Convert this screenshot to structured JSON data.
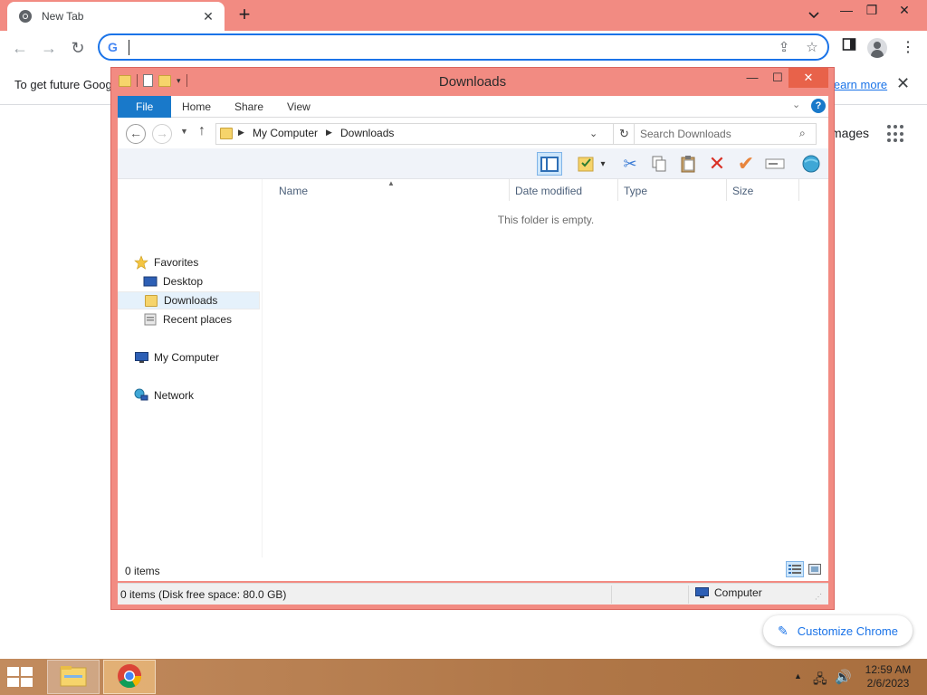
{
  "browser": {
    "tab": {
      "title": "New Tab",
      "favicon": "chrome-icon"
    },
    "omnibox": {
      "value": "",
      "placeholder": ""
    },
    "infobar": {
      "text": "To get future Goog",
      "link": "learn more"
    },
    "ntp": {
      "images_link": "mages",
      "customize_label": "Customize Chrome"
    }
  },
  "explorer": {
    "title": "Downloads",
    "ribbon_tabs": [
      "File",
      "Home",
      "Share",
      "View"
    ],
    "address": {
      "crumbs": [
        "My Computer",
        "Downloads"
      ]
    },
    "search": {
      "placeholder": "Search Downloads"
    },
    "nav": {
      "favorites": "Favorites",
      "desktop": "Desktop",
      "downloads": "Downloads",
      "recent": "Recent places",
      "computer": "My Computer",
      "network": "Network"
    },
    "columns": [
      "Name",
      "Date modified",
      "Type",
      "Size"
    ],
    "empty_message": "This folder is empty.",
    "item_count": "0 items",
    "status": {
      "left": "0 items (Disk free space: 80.0 GB)",
      "right": "Computer"
    }
  },
  "taskbar": {
    "clock": {
      "time": "12:59 AM",
      "date": "2/6/2023"
    }
  },
  "colors": {
    "accent": "#1a73e8",
    "chrome_frame": "#f28b82",
    "ribbon_file": "#1979ca",
    "close_button": "#e8624a"
  }
}
